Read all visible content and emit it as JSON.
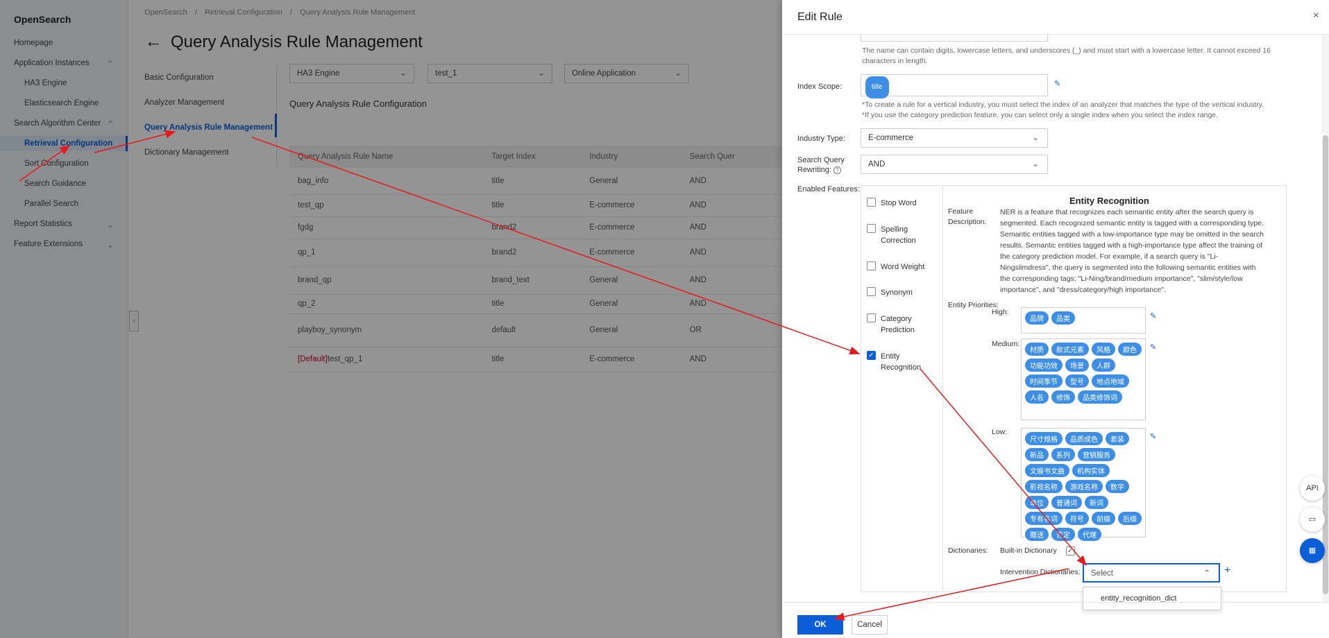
{
  "sidebar": {
    "brand": "OpenSearch",
    "items": [
      {
        "label": "Homepage"
      },
      {
        "label": "Application Instances"
      },
      {
        "label": "HA3 Engine"
      },
      {
        "label": "Elasticsearch Engine"
      },
      {
        "label": "Search Algorithm Center"
      },
      {
        "label": "Retrieval Configuration"
      },
      {
        "label": "Sort Configuration"
      },
      {
        "label": "Search Guidance"
      },
      {
        "label": "Parallel Search"
      },
      {
        "label": "Report Statistics"
      },
      {
        "label": "Feature Extensions"
      }
    ]
  },
  "breadcrumb": [
    "OpenSearch",
    "/",
    "Retrieval Configuration",
    "/",
    "Query Analysis Rule Management"
  ],
  "page_title": "Query Analysis Rule Management",
  "subnav": [
    "Basic Configuration",
    "Analyzer Management",
    "Query Analysis Rule Management",
    "Dictionary Management"
  ],
  "filters": {
    "engine": "HA3 Engine",
    "app": "test_1",
    "app_type": "Online Application"
  },
  "section_title": "Query Analysis Rule Configuration",
  "table": {
    "headers": [
      "Query Analysis Rule Name",
      "Target Index",
      "Industry",
      "Search Quer"
    ],
    "rows": [
      {
        "name": "bag_info",
        "index": "title",
        "industry": "General",
        "rewrite": "AND"
      },
      {
        "name": "test_qp",
        "index": "title",
        "industry": "E-commerce",
        "rewrite": "AND"
      },
      {
        "name": "fgdg",
        "index": "brand2",
        "industry": "E-commerce",
        "rewrite": "AND"
      },
      {
        "name": "qp_1",
        "index": "brand2",
        "industry": "E-commerce",
        "rewrite": "AND"
      },
      {
        "name": "brand_qp",
        "index": "brand_text",
        "industry": "General",
        "rewrite": "AND"
      },
      {
        "name": "qp_2",
        "index": "title",
        "industry": "General",
        "rewrite": "AND"
      },
      {
        "name": "playboy_synonym",
        "index": "default",
        "industry": "General",
        "rewrite": "OR"
      },
      {
        "prefix": "[Default]",
        "name": "test_qp_1",
        "index": "title",
        "industry": "E-commerce",
        "rewrite": "AND"
      }
    ]
  },
  "drawer": {
    "title": "Edit Rule",
    "close_icon": "×",
    "name_hint": "The name can contain digits, lowercase letters, and underscores (_) and must start with a lowercase letter. It cannot exceed 16 characters in length.",
    "index_scope_label": "Index Scope:",
    "index_scope_tag": "title",
    "index_hint_1": "*To create a rule for a vertical industry, you must select the index of an analyzer that matches the type of the vertical industry.",
    "index_hint_2": "*If you use the category prediction feature, you can select only a single index when you select the index range.",
    "industry_label": "Industry Type:",
    "industry_value": "E-commerce",
    "rewrite_label_1": "Search Query",
    "rewrite_label_2": "Rewriting:",
    "rewrite_value": "AND",
    "features_label": "Enabled Features:",
    "features": [
      {
        "label": "Stop Word",
        "checked": false
      },
      {
        "label": "Spelling Correction",
        "checked": false
      },
      {
        "label": "Word Weight",
        "checked": false
      },
      {
        "label": "Synonym",
        "checked": false
      },
      {
        "label": "Category Prediction",
        "checked": false
      },
      {
        "label": "Entity Recognition",
        "checked": true
      }
    ],
    "entity_title": "Entity Recognition",
    "feature_desc_label": "Feature Description:",
    "feature_desc": "NER is a feature that recognizes each semantic entity after the search query is segmented. Each recognized semantic entity is tagged with a corresponding type. Semantic entities tagged with a low-importance type may be omitted in the search results. Semantic entities tagged with a high-importance type affect the training of the category prediction model. For example, if a search query is \"Li-Ningslimdress\", the query is segmented into the following semantic entities with the corresponding tags: \"Li-Ning/brand/medium importance\", \"slim/style/low importance\", and \"dress/category/high importance\".",
    "priorities_label": "Entity Priorities:",
    "high_label": "High:",
    "medium_label": "Medium:",
    "low_label": "Low:",
    "high_tags": [
      "品牌",
      "品类"
    ],
    "medium_tags": [
      "材质",
      "款式元素",
      "风格",
      "颜色",
      "功能功效",
      "场景",
      "人群",
      "时间季节",
      "型号",
      "地点地域",
      "人名",
      "修饰",
      "品类修饰词"
    ],
    "low_tags": [
      "尺寸规格",
      "品质成色",
      "套装",
      "新品",
      "系列",
      "营销服务",
      "文娱书文曲",
      "机构实体",
      "影视名称",
      "游戏名称",
      "数字",
      "单位",
      "普通词",
      "新词",
      "专有名词",
      "符号",
      "前缀",
      "后缀",
      "赠送",
      "否定",
      "代理"
    ],
    "dictionaries_label": "Dictionaries:",
    "builtin_dict_label": "Built-in Dictionary",
    "intervention_label": "Intervention Dictionaries:",
    "intervention_placeholder": "Select",
    "dropdown_option": "entity_recognition_dict",
    "ok_label": "OK",
    "cancel_label": "Cancel"
  },
  "float_buttons": [
    "API",
    "chat",
    "apps"
  ],
  "colors": {
    "accent": "#0b5ed7",
    "tag": "#3d8ee6",
    "annotation_arrow": "#e8191b"
  }
}
